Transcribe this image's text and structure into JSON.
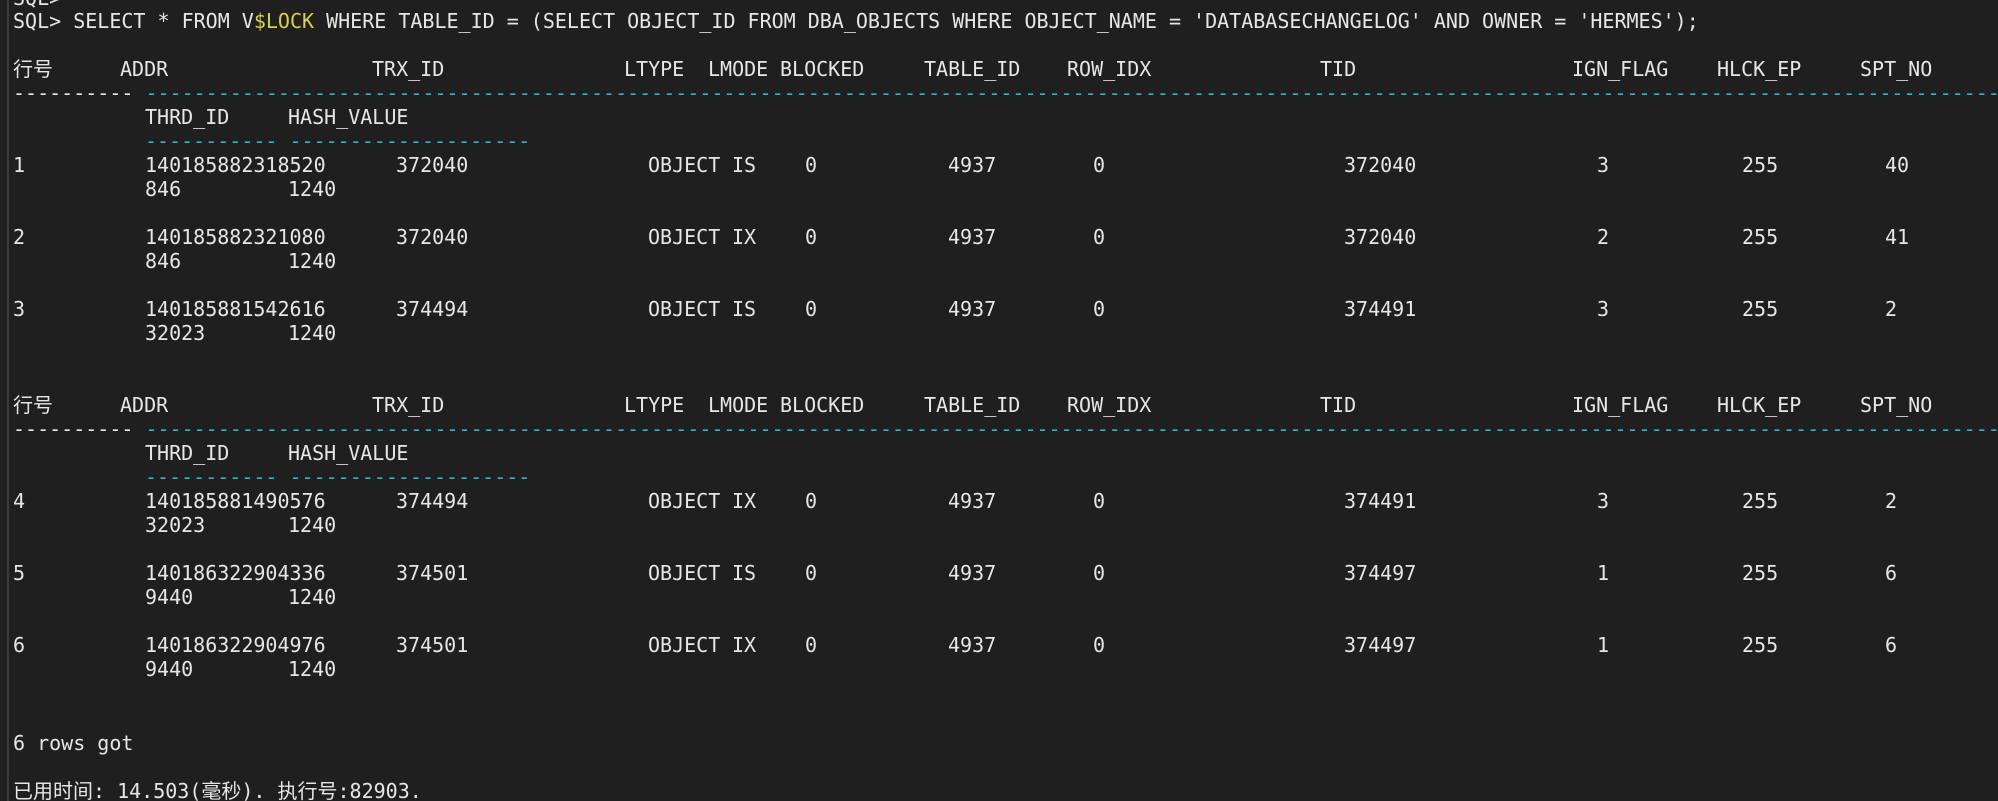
{
  "terminal": {
    "prev_prompt": "SQL>",
    "query": {
      "prompt": "SQL>",
      "text_before": " SELECT * FROM V",
      "highlight": "$LOCK",
      "text_after": " WHERE TABLE_ID = (SELECT OBJECT_ID FROM DBA_OBJECTS WHERE OBJECT_NAME = 'DATABASECHANGELOG' AND OWNER = 'HERMES');"
    },
    "headers": [
      "行号",
      "ADDR",
      "TRX_ID",
      "LTYPE",
      "LMODE",
      "BLOCKED",
      "TABLE_ID",
      "ROW_IDX",
      "TID",
      "IGN_FLAG",
      "HLCK_EP",
      "SPT_NO"
    ],
    "sub_headers": [
      "THRD_ID",
      "HASH_VALUE"
    ],
    "groups": [
      {
        "rows": [
          {
            "no": "1",
            "addr": "140185882318520",
            "trx_id": "372040",
            "ltype": "OBJECT",
            "lmode": "IS",
            "blocked": "0",
            "table_id": "4937",
            "row_idx": "0",
            "tid": "372040",
            "ign_flag": "3",
            "hlck_ep": "255",
            "spt_no": "40",
            "thrd_id": "846",
            "hash_value": "1240"
          },
          {
            "no": "2",
            "addr": "140185882321080",
            "trx_id": "372040",
            "ltype": "OBJECT",
            "lmode": "IX",
            "blocked": "0",
            "table_id": "4937",
            "row_idx": "0",
            "tid": "372040",
            "ign_flag": "2",
            "hlck_ep": "255",
            "spt_no": "41",
            "thrd_id": "846",
            "hash_value": "1240"
          },
          {
            "no": "3",
            "addr": "140185881542616",
            "trx_id": "374494",
            "ltype": "OBJECT",
            "lmode": "IS",
            "blocked": "0",
            "table_id": "4937",
            "row_idx": "0",
            "tid": "374491",
            "ign_flag": "3",
            "hlck_ep": "255",
            "spt_no": "2",
            "thrd_id": "32023",
            "hash_value": "1240"
          }
        ]
      },
      {
        "rows": [
          {
            "no": "4",
            "addr": "140185881490576",
            "trx_id": "374494",
            "ltype": "OBJECT",
            "lmode": "IX",
            "blocked": "0",
            "table_id": "4937",
            "row_idx": "0",
            "tid": "374491",
            "ign_flag": "3",
            "hlck_ep": "255",
            "spt_no": "2",
            "thrd_id": "32023",
            "hash_value": "1240"
          },
          {
            "no": "5",
            "addr": "140186322904336",
            "trx_id": "374501",
            "ltype": "OBJECT",
            "lmode": "IS",
            "blocked": "0",
            "table_id": "4937",
            "row_idx": "0",
            "tid": "374497",
            "ign_flag": "1",
            "hlck_ep": "255",
            "spt_no": "6",
            "thrd_id": "9440",
            "hash_value": "1240"
          },
          {
            "no": "6",
            "addr": "140186322904976",
            "trx_id": "374501",
            "ltype": "OBJECT",
            "lmode": "IX",
            "blocked": "0",
            "table_id": "4937",
            "row_idx": "0",
            "tid": "374497",
            "ign_flag": "1",
            "hlck_ep": "255",
            "spt_no": "6",
            "thrd_id": "9440",
            "hash_value": "1240"
          }
        ]
      }
    ],
    "rows_got": "6 rows got",
    "elapsed": "已用时间: 14.503(毫秒). 执行号:82903."
  }
}
